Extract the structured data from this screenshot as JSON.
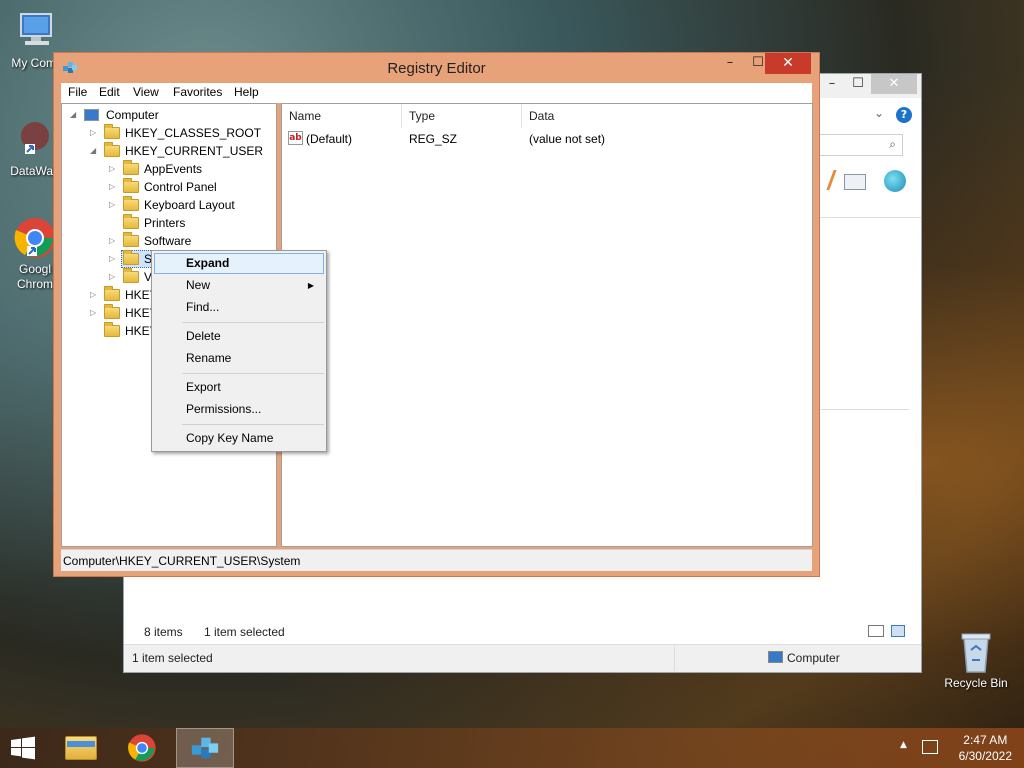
{
  "desktop": {
    "icons": [
      {
        "label": "My Comp"
      },
      {
        "label": "DataWag"
      },
      {
        "label": "Googl\nChrom"
      },
      {
        "label": "Recycle Bin"
      }
    ]
  },
  "explorer_bg": {
    "items_count": "8 items",
    "selected_count": "1 item selected",
    "status_left": "1 item selected",
    "status_right": "Computer",
    "search_icon": "magnifier-icon",
    "help_icon": "help-icon"
  },
  "regedit": {
    "title": "Registry Editor",
    "window_buttons": {
      "minimize": "–",
      "maximize": "☐",
      "close": "✕"
    },
    "menu": [
      "File",
      "Edit",
      "View",
      "Favorites",
      "Help"
    ],
    "tree": {
      "root": "Computer",
      "hives": [
        "HKEY_CLASSES_ROOT",
        "HKEY_CURRENT_USER",
        "HKEY",
        "HKEY",
        "HKEY"
      ],
      "current_user_children": [
        "AppEvents",
        "Control Panel",
        "Keyboard Layout",
        "Printers",
        "Software",
        "Sy",
        "V"
      ]
    },
    "columns": [
      "Name",
      "Type",
      "Data"
    ],
    "rows": [
      {
        "name": "(Default)",
        "type": "REG_SZ",
        "data": "(value not set)",
        "icon": "string-value-icon"
      }
    ],
    "statusbar": "Computer\\HKEY_CURRENT_USER\\System"
  },
  "context_menu": {
    "items": [
      {
        "label": "Expand",
        "highlighted": true
      },
      {
        "label": "New",
        "submenu": true
      },
      {
        "label": "Find..."
      },
      {
        "label": "Delete"
      },
      {
        "label": "Rename"
      },
      {
        "label": "Export"
      },
      {
        "label": "Permissions..."
      },
      {
        "label": "Copy Key Name"
      }
    ]
  },
  "taskbar": {
    "time": "2:47 AM",
    "date": "6/30/2022"
  },
  "colors": {
    "window_frame": "#e8a27a",
    "close_button": "#c83a2a",
    "selection": "#cde4fb"
  }
}
